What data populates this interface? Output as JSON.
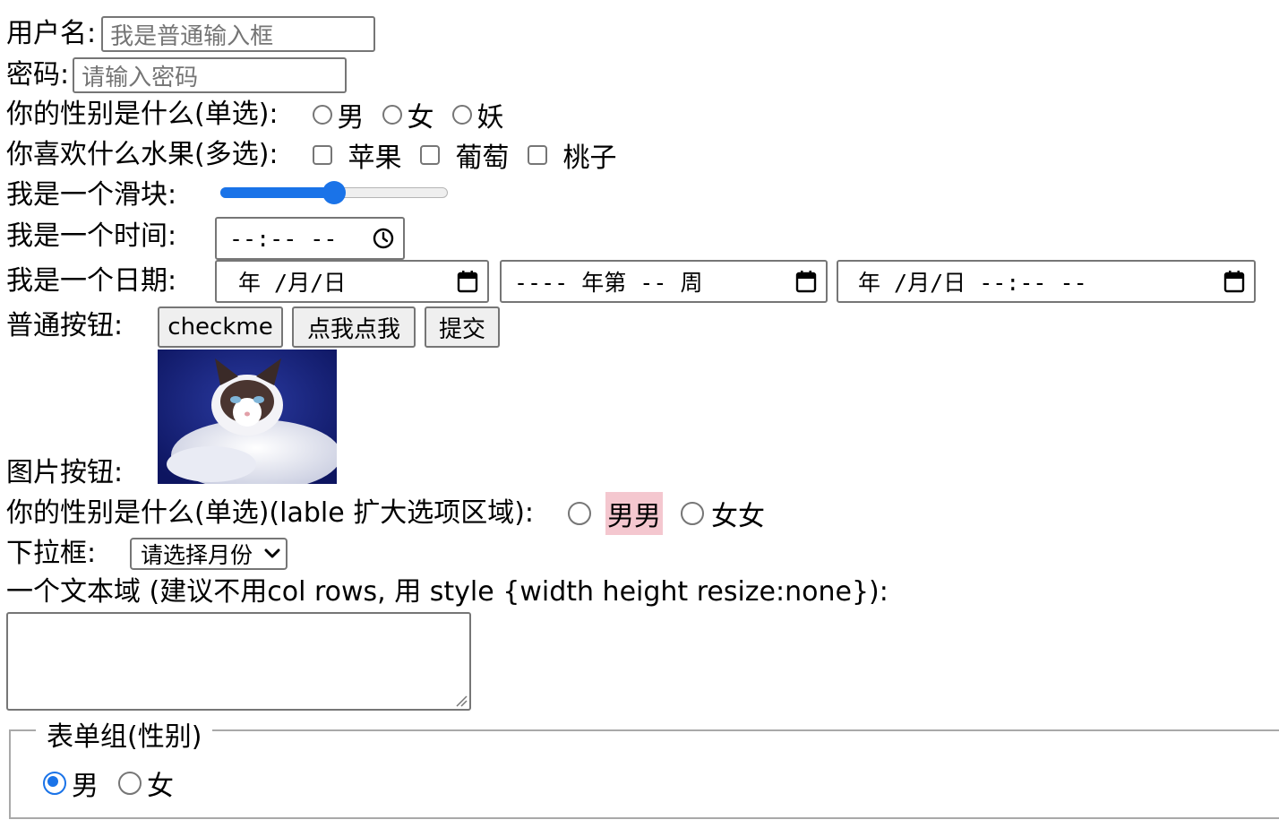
{
  "username": {
    "label": "用户名:",
    "placeholder": "我是普通输入框"
  },
  "password": {
    "label": "密码:",
    "placeholder": "请输入密码"
  },
  "gender": {
    "label": "你的性别是什么(单选):",
    "options": [
      "男",
      "女",
      "妖"
    ]
  },
  "fruit": {
    "label": "你喜欢什么水果(多选):",
    "options": [
      "苹果",
      "葡萄",
      "桃子"
    ]
  },
  "slider": {
    "label": "我是一个滑块:",
    "value_fraction": 0.5
  },
  "time": {
    "label": "我是一个时间:",
    "value": "--:-- --"
  },
  "date": {
    "label": "我是一个日期:",
    "date_value": "年 /月/日",
    "week_value": "---- 年第 -- 周",
    "datetime_value": "年 /月/日 --:-- --"
  },
  "buttons": {
    "label": "普通按钮:",
    "items": [
      "checkme",
      "点我点我",
      "提交"
    ]
  },
  "image_button": {
    "label": "图片按钮:"
  },
  "gender2": {
    "label": "你的性别是什么(单选)(lable 扩大选项区域):",
    "options": [
      "男男",
      "女女"
    ]
  },
  "select": {
    "label": "下拉框:",
    "value": "请选择月份"
  },
  "textarea": {
    "label": "一个文本域 (建议不用col rows, 用 style {width height resize:none}):"
  },
  "fieldset": {
    "legend": "表单组(性别)",
    "options": [
      "男",
      "女"
    ],
    "checked_index": 0
  },
  "colors": {
    "accent": "#1a73e8",
    "highlight": "#f4c7cf"
  },
  "icons": [
    "clock-icon",
    "calendar-icon",
    "chevron-down-icon",
    "resize-grip-icon"
  ]
}
